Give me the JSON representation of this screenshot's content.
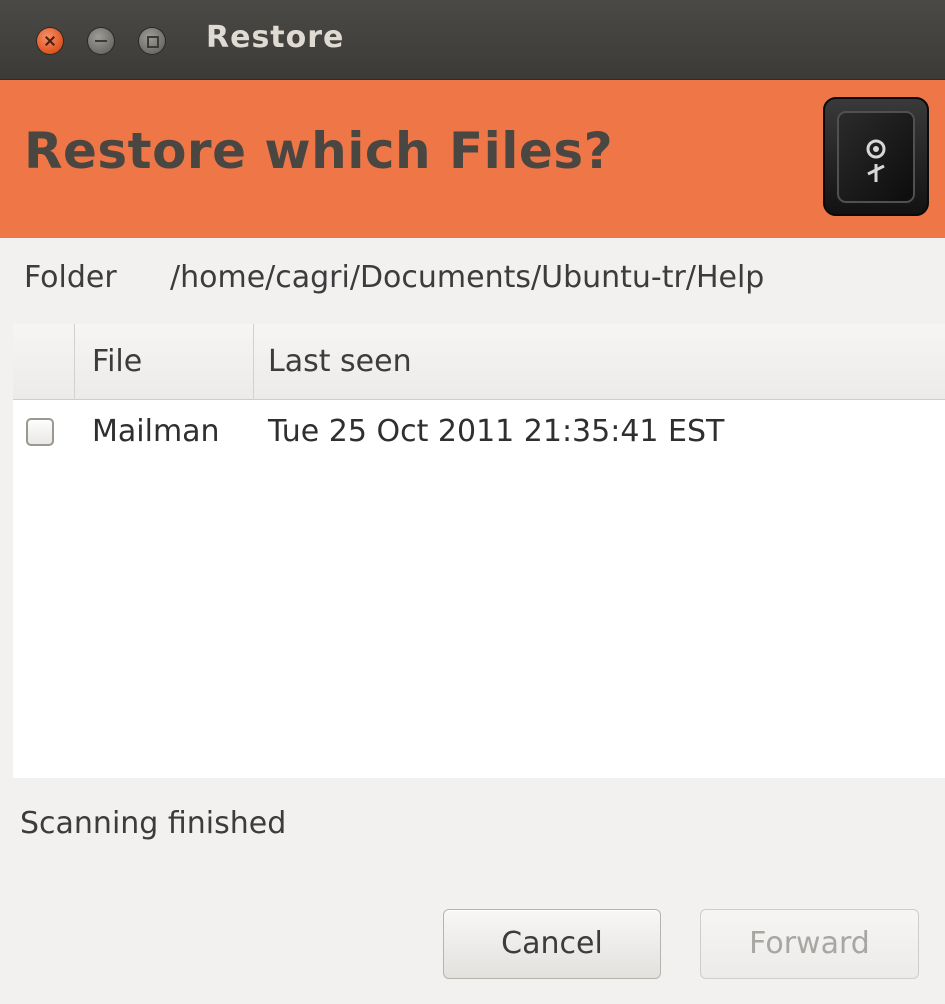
{
  "window": {
    "title": "Restore"
  },
  "header": {
    "title": "Restore which Files?",
    "icon": "safe-icon",
    "color": "#ef7647"
  },
  "folder": {
    "label": "Folder",
    "path": "/home/cagri/Documents/Ubuntu-tr/Help"
  },
  "table": {
    "columns": [
      "File",
      "Last seen"
    ],
    "rows": [
      {
        "checked": false,
        "file": "Mailman",
        "last_seen": "Tue 25 Oct 2011 21:35:41 EST"
      }
    ]
  },
  "status": "Scanning finished",
  "buttons": {
    "cancel": "Cancel",
    "forward": "Forward",
    "forward_enabled": false
  }
}
